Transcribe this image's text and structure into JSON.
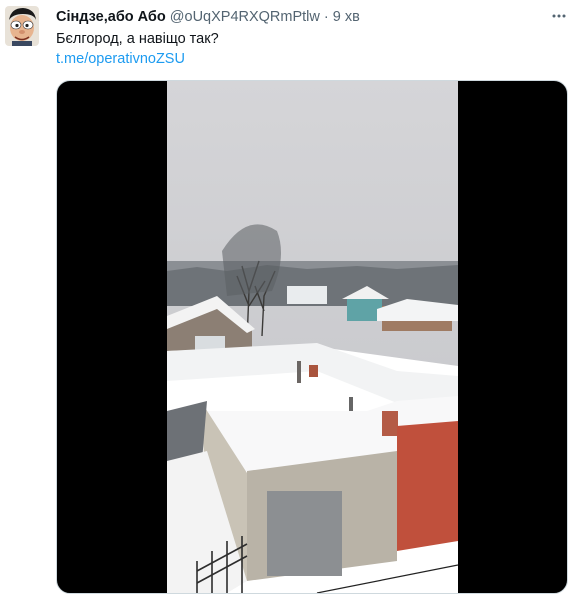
{
  "tweet": {
    "author_name": "Сіндзе,або Або",
    "handle": "@oUqXP4RXQRmPtlw",
    "separator": "·",
    "time": "9 хв",
    "text": "Бєлгород, а навіщо так?",
    "link_text": "t.me/operativnoZSU"
  },
  "icons": {
    "avatar": "caricature-avatar",
    "more": "more-icon"
  },
  "colors": {
    "link": "#1d9bf0",
    "secondary_text": "#536471",
    "media_background": "#000000"
  }
}
